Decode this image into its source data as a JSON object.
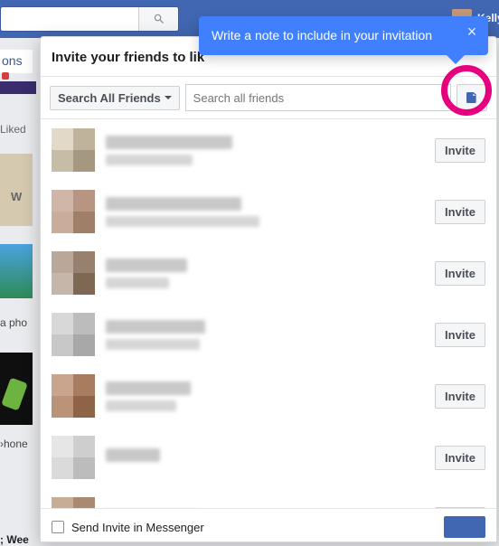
{
  "topnav": {
    "username": "Kelly"
  },
  "bg": {
    "tabs_label": "ons",
    "liked": "Liked",
    "wk": "W",
    "a_pho": "a pho",
    "phone": "›hone",
    "week": "; Wee"
  },
  "modal": {
    "title": "Invite your friends to lik",
    "dropdown_label": "Search All Friends",
    "search_placeholder": "Search all friends",
    "invite_label": "Invite",
    "footer_checkbox_label": "Send Invite in Messenger"
  },
  "tooltip": {
    "text": "Write a note to include in your invitation"
  },
  "friends": [
    {
      "c": [
        "#e2d9c8",
        "#bfb49b",
        "#c7bca6",
        "#a59780"
      ],
      "w1": 140,
      "w2": 96
    },
    {
      "c": [
        "#d0b6a8",
        "#b69682",
        "#c9ac9a",
        "#a07f68"
      ],
      "w1": 150,
      "w2": 170
    },
    {
      "c": [
        "#b9a79a",
        "#97816e",
        "#c6b6a9",
        "#7e6753"
      ],
      "w1": 90,
      "w2": 70
    },
    {
      "c": [
        "#d8d8d8",
        "#bcbcbc",
        "#c8c8c8",
        "#a8a8a8"
      ],
      "w1": 110,
      "w2": 104
    },
    {
      "c": [
        "#c9a58e",
        "#a87c5e",
        "#bb9378",
        "#8e6446"
      ],
      "w1": 94,
      "w2": 78
    },
    {
      "c": [
        "#e6e6e6",
        "#cecece",
        "#dadada",
        "#bcbcbc"
      ],
      "w1": 60,
      "w2": 0
    },
    {
      "c": [
        "#c7ac96",
        "#a98a70",
        "#b99c84",
        "#926f54"
      ],
      "w1": 100,
      "w2": 0
    }
  ]
}
